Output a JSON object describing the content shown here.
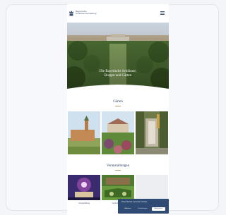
{
  "header": {
    "brand_line1": "Bayerische",
    "brand_line2": "Schlösserverwaltung",
    "brand_line3": "",
    "logo_icon": "crown-crest-icon",
    "menu_icon": "hamburger-menu-icon"
  },
  "hero": {
    "title": "Die Bayerische Schlösser, Burgen und Gärten"
  },
  "sections": {
    "gardens_title": "Gärten",
    "events_title": "Veranstaltungen"
  },
  "events": [
    {
      "caption": "Veranstaltung"
    },
    {
      "caption": "Gartenführung"
    }
  ],
  "cookie": {
    "text": "Diese Website verwendet Cookies",
    "decline": "Ablehnen",
    "settings": "Einstellungen",
    "accept": "Akzeptieren"
  },
  "colors": {
    "brand_navy": "#2f4a73",
    "accent_gold": "#b9a26a"
  }
}
